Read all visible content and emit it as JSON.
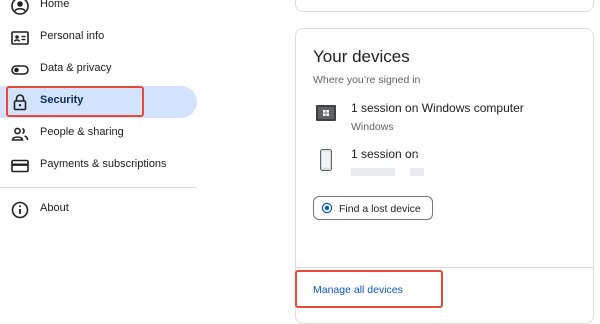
{
  "sidebar": {
    "items": [
      {
        "label": "Home",
        "icon": "account-circle-icon"
      },
      {
        "label": "Personal info",
        "icon": "id-card-icon"
      },
      {
        "label": "Data & privacy",
        "icon": "toggle-icon"
      },
      {
        "label": "Security",
        "icon": "lock-icon",
        "active": true
      },
      {
        "label": "People & sharing",
        "icon": "people-icon"
      },
      {
        "label": "Payments & subscriptions",
        "icon": "credit-card-icon"
      },
      {
        "label": "About",
        "icon": "info-icon"
      }
    ]
  },
  "devices_card": {
    "title": "Your devices",
    "subtitle": "Where you’re signed in",
    "devices": [
      {
        "title": "1 session on Windows computer",
        "subtitle": "Windows",
        "icon": "laptop-icon"
      },
      {
        "title": "1 session on",
        "subtitle": "",
        "icon": "phone-icon"
      }
    ],
    "find_button_label": "Find a lost device",
    "manage_link": "Manage all devices"
  },
  "colors": {
    "accent": "#0b57d0",
    "active_bg": "#d3e3fd",
    "highlight": "#e84a37"
  }
}
